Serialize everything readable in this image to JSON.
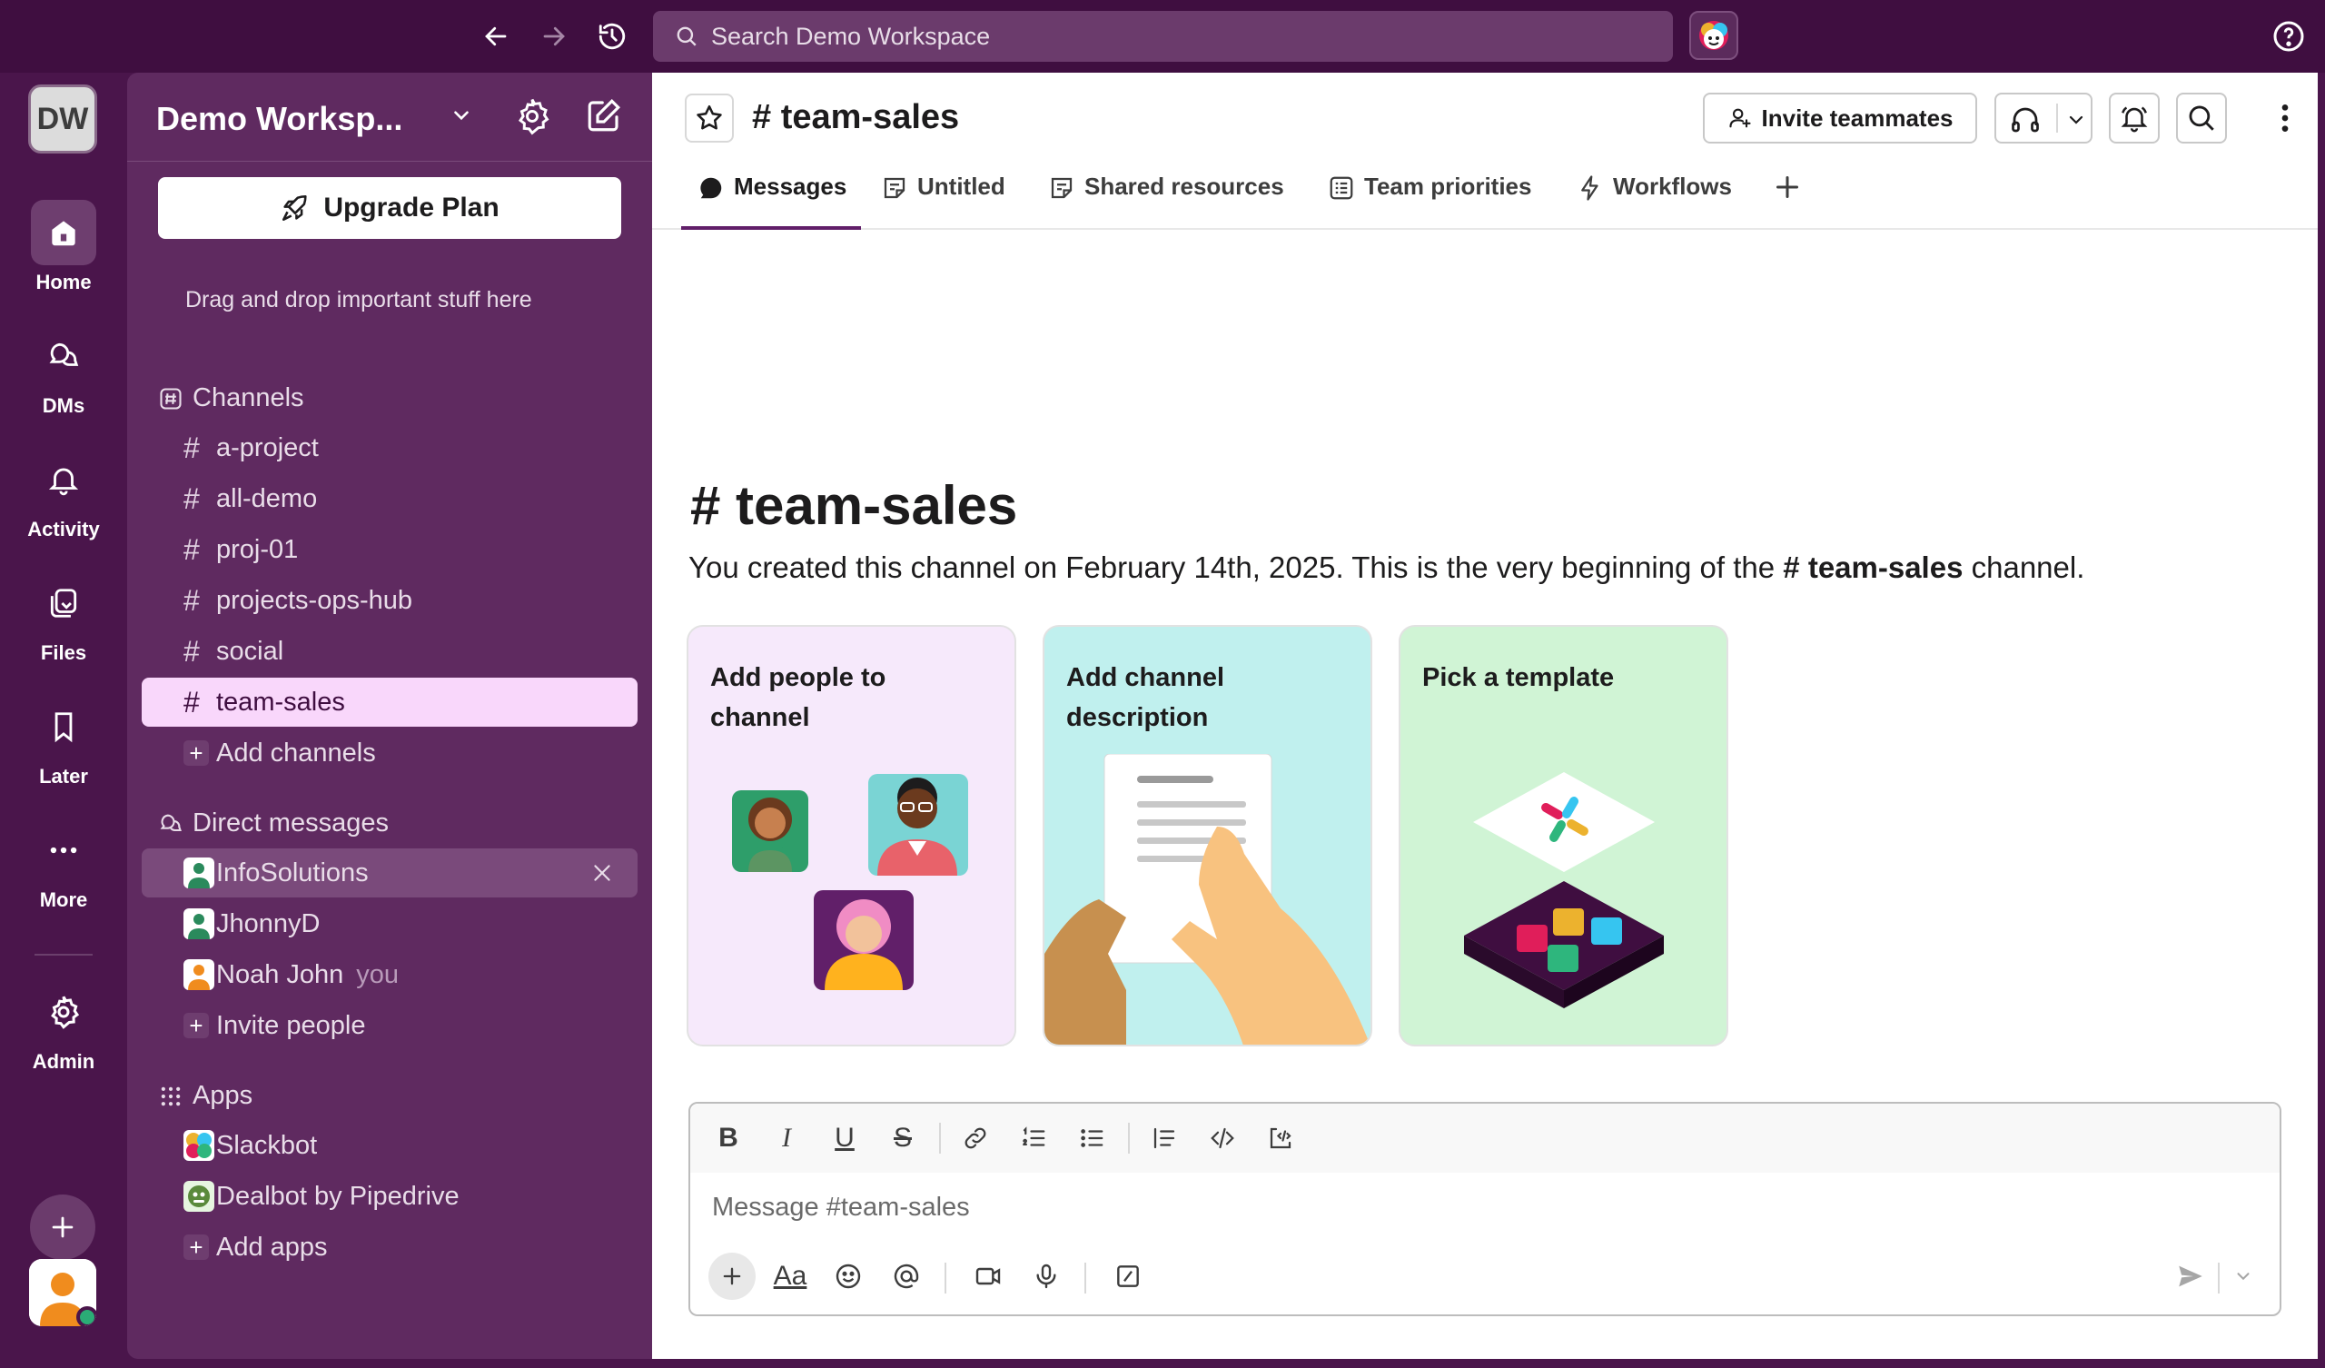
{
  "topbar": {
    "search_placeholder": "Search Demo Workspace",
    "back_icon": "arrow-left-icon",
    "forward_icon": "arrow-right-icon",
    "history_icon": "history-icon"
  },
  "rail": {
    "workspace_initials": "DW",
    "items": [
      {
        "label": "Home",
        "icon": "home-icon"
      },
      {
        "label": "DMs",
        "icon": "dms-icon"
      },
      {
        "label": "Activity",
        "icon": "bell-icon"
      },
      {
        "label": "Files",
        "icon": "files-icon"
      },
      {
        "label": "Later",
        "icon": "bookmark-icon"
      },
      {
        "label": "More",
        "icon": "more-icon"
      },
      {
        "label": "Admin",
        "icon": "gear-icon"
      }
    ]
  },
  "sidebar": {
    "workspace_name": "Demo Worksp...",
    "upgrade_label": "Upgrade Plan",
    "starred_hint": "Drag and drop important stuff here",
    "channels_header": "Channels",
    "channels": [
      "a-project",
      "all-demo",
      "proj-01",
      "projects-ops-hub",
      "social",
      "team-sales"
    ],
    "selected_channel": "team-sales",
    "add_channels": "Add channels",
    "dm_header": "Direct messages",
    "dms": [
      {
        "name": "InfoSolutions",
        "tag": ""
      },
      {
        "name": "JhonnyD",
        "tag": ""
      },
      {
        "name": "Noah John",
        "tag": "you"
      }
    ],
    "invite_people": "Invite people",
    "apps_header": "Apps",
    "apps": [
      "Slackbot",
      "Dealbot by Pipedrive"
    ],
    "add_apps": "Add apps"
  },
  "channel": {
    "hash": "#",
    "name": "team-sales",
    "invite_label": "Invite teammates",
    "tabs": [
      "Messages",
      "Untitled",
      "Shared resources",
      "Team priorities",
      "Workflows"
    ],
    "intro_pre": "You created this channel on February 14th, 2025. This is the very beginning of the",
    "intro_post": "channel.",
    "cards": [
      {
        "title": "Add people to channel"
      },
      {
        "title": "Add channel description"
      },
      {
        "title": "Pick a template"
      }
    ]
  },
  "composer": {
    "placeholder": "Message #team-sales",
    "format_labels": {
      "bold": "B",
      "italic": "I",
      "underline": "U",
      "strike": "S",
      "text_style": "Aa"
    }
  },
  "colors": {
    "aubergine": "#4a154b",
    "sidebar": "#5f2a60",
    "selected": "#f9d7fb",
    "tab_active": "#611f69"
  }
}
